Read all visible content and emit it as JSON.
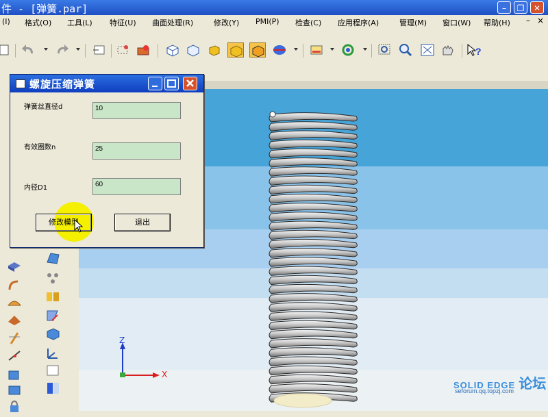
{
  "window": {
    "title": "件 - [弹簧.par]"
  },
  "menu": [
    "(I)",
    "格式(O)",
    "工具(L)",
    "特征(U)",
    "曲面处理(R)",
    "修改(Y)",
    "PMI(P)",
    "检查(C)",
    "应用程序(A)",
    "管理(M)",
    "窗口(W)",
    "帮助(H)"
  ],
  "dialog": {
    "title": "螺旋压缩弹簧",
    "fields": [
      {
        "label": "弹簧丝直径d",
        "value": "10"
      },
      {
        "label": "有效圈数n",
        "value": "25"
      },
      {
        "label": "内径D1",
        "value": "60"
      }
    ],
    "modify_button": "修改模型",
    "exit_button": "退出"
  },
  "axes": {
    "z_label": "Z",
    "x_label": "X"
  },
  "watermark": {
    "brand": "SOLID EDGE",
    "forum": "论坛",
    "url": "seforum.qq.topzj.com"
  },
  "colors": {
    "dialog_title": "#1e4fc4",
    "field_bg": "#c9e6c9",
    "highlight": "#f5f000"
  }
}
